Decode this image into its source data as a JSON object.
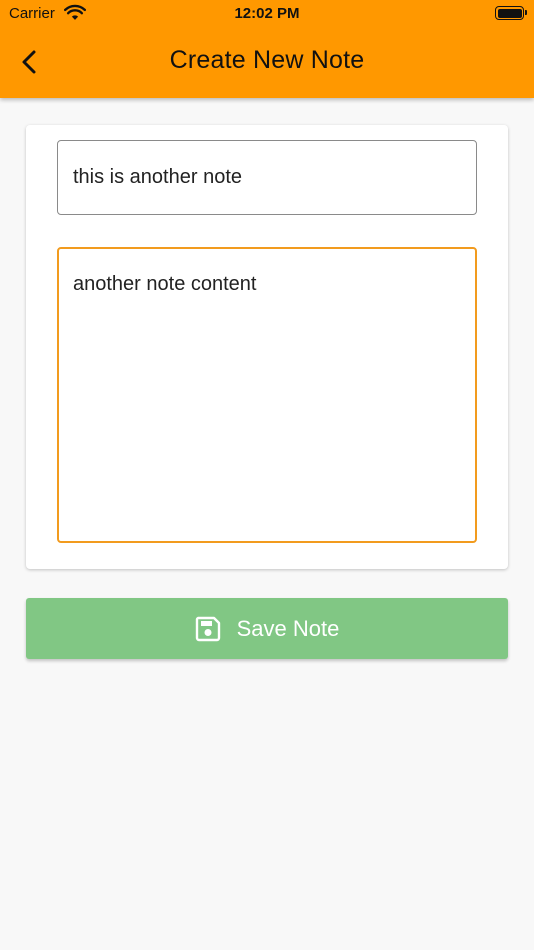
{
  "status_bar": {
    "carrier": "Carrier",
    "time": "12:02 PM"
  },
  "header": {
    "title": "Create New Note",
    "back_icon": "chevron-left-icon",
    "background_color": "#ff9800"
  },
  "form": {
    "title_input": {
      "value": "this is another note",
      "placeholder": ""
    },
    "content_input": {
      "value": "another note content",
      "placeholder": "",
      "focus_color": "#f29b1e"
    }
  },
  "save_button": {
    "label": "Save Note",
    "icon": "save-icon",
    "background_color": "#81c784"
  }
}
